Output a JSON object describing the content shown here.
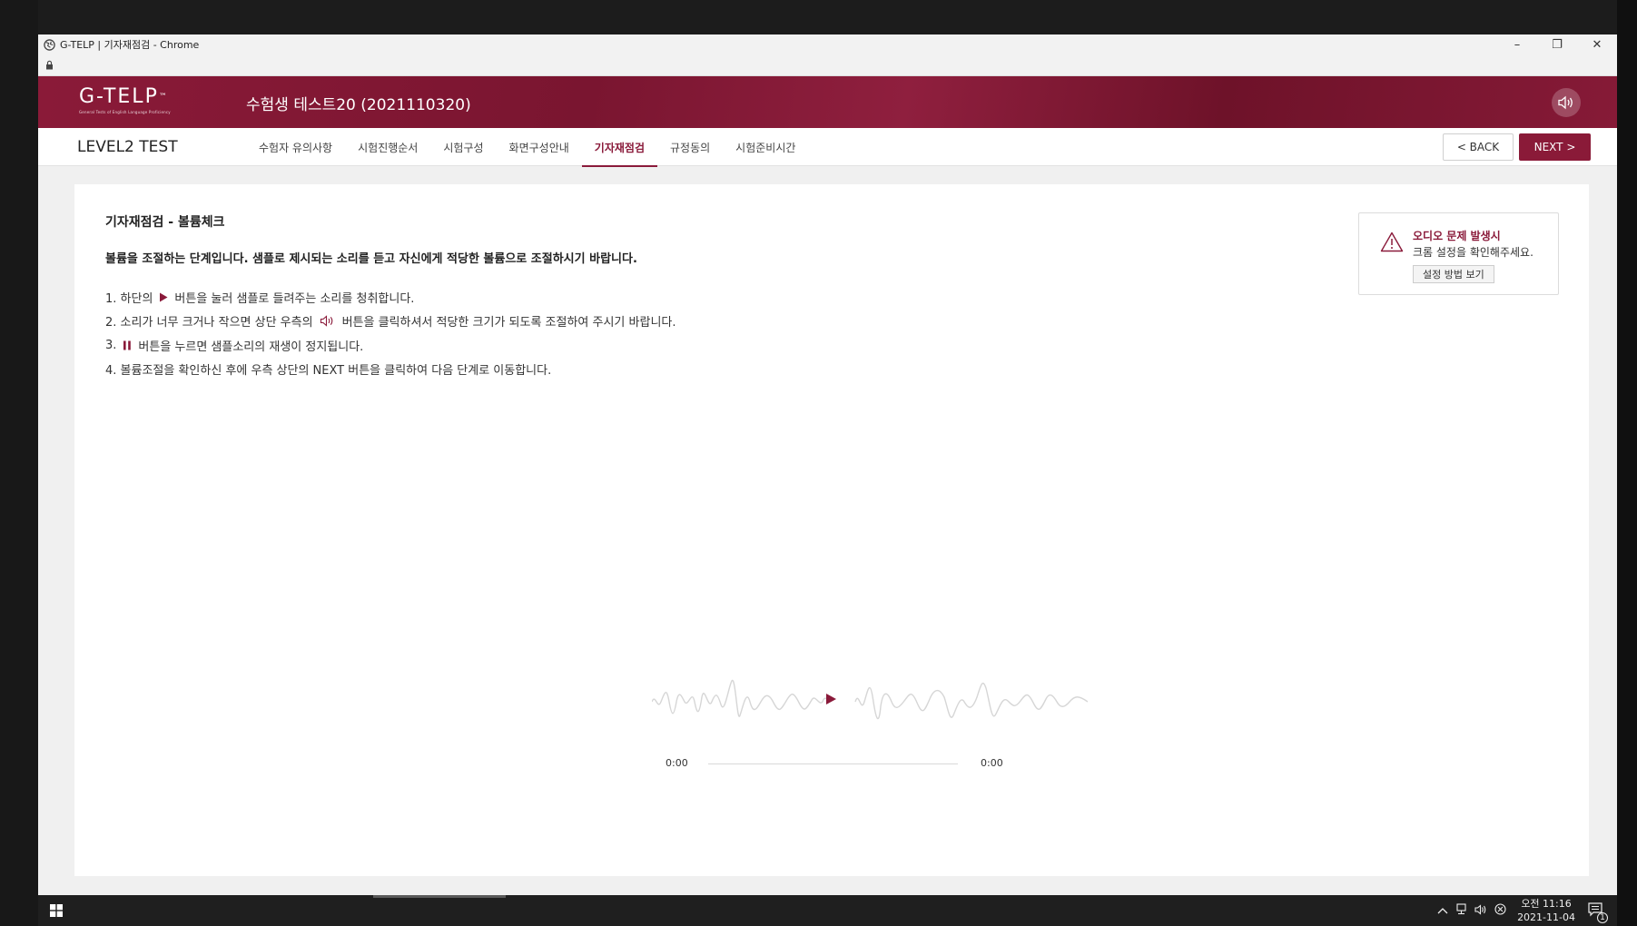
{
  "browser": {
    "window_title": "G-TELP | 기자재점검 - Chrome",
    "controls": {
      "minimize": "–",
      "restore": "❐",
      "close": "✕"
    }
  },
  "header": {
    "logo_text": "G-TELP",
    "logo_tm": "™",
    "logo_tagline": "General Tests of English Language Proficiency",
    "candidate": "수험생 테스트20 (2021110320)"
  },
  "nav": {
    "level": "LEVEL2 TEST",
    "tabs": [
      {
        "label": "수험자 유의사항"
      },
      {
        "label": "시험진행순서"
      },
      {
        "label": "시험구성"
      },
      {
        "label": "화면구성안내"
      },
      {
        "label": "기자재점검",
        "active": true
      },
      {
        "label": "규정동의"
      },
      {
        "label": "시험준비시간"
      }
    ],
    "back_label": "< BACK",
    "next_label": "NEXT >"
  },
  "content": {
    "title": "기자재점검 - 볼륨체크",
    "subtitle": "볼륨을 조절하는 단계입니다. 샘플로 제시되는 소리를 듣고 자신에게 적당한 볼륨으로 조절하시기 바랍니다.",
    "steps": [
      {
        "pre": "1. 하단의",
        "post": "버튼을 눌러 샘플로 들려주는 소리를 청취합니다."
      },
      {
        "pre": "2. 소리가 너무 크거나 작으면 상단 우측의",
        "post": "버튼을 클릭하셔서 적당한 크기가 되도록 조절하여 주시기 바랍니다."
      },
      {
        "pre": "3.",
        "post": "버튼을 누르면 샘플소리의 재생이 정지됩니다."
      },
      {
        "pre": "4. 볼륨조절을 확인하신 후에 우측 상단의 NEXT 버튼을 클릭하여 다음 단계로 이동합니다.",
        "post": ""
      }
    ]
  },
  "alert": {
    "title": "오디오 문제 발생시",
    "text": "크롬 설정을 확인해주세요.",
    "button": "설정 방법 보기"
  },
  "player": {
    "current_time": "0:00",
    "duration": "0:00"
  },
  "taskbar": {
    "time": "오전 11:16",
    "date": "2021-11-04",
    "notification_count": "1"
  },
  "colors": {
    "brand": "#8a1a38",
    "accent": "#8a1a3a"
  }
}
